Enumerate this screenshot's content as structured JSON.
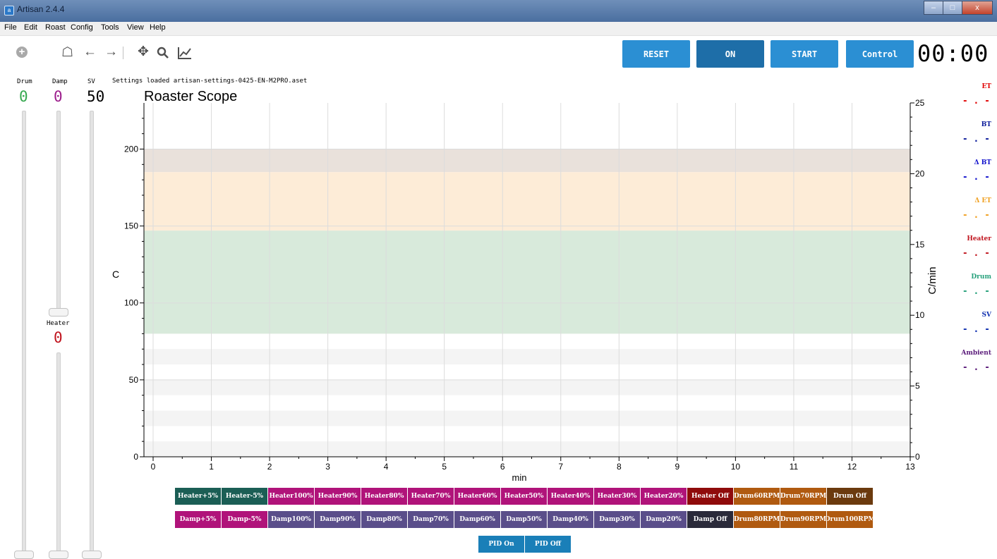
{
  "window": {
    "title": "Artisan 2.4.4",
    "minimize": "–",
    "maximize": "□",
    "close": "x"
  },
  "menu": [
    "File",
    "Edit",
    "Roast",
    "Config",
    "Tools",
    "View",
    "Help"
  ],
  "toolbar_icons": [
    "add-icon",
    "home-icon",
    "back-arrow-icon",
    "forward-arrow-icon",
    "pan-icon",
    "zoom-icon",
    "line-chart-icon"
  ],
  "controls": {
    "reset": "RESET",
    "on": "ON",
    "start": "START",
    "control": "Control"
  },
  "timer": "00:00",
  "lcds": {
    "drum_label": "Drum",
    "drum_value": "0",
    "damp_label": "Damp",
    "damp_value": "0",
    "sv_label": "SV",
    "sv_value": "50",
    "heater_label": "Heater",
    "heater_value": "0"
  },
  "colors": {
    "drum": "#36a84f",
    "damp": "#9c1e8c",
    "sv": "#000000",
    "heater": "#c0141e",
    "zone_top": "#e8e2dc",
    "zone_mid": "#fdecd6",
    "zone_low": "#d7eadb"
  },
  "status_message": "Settings loaded artisan-settings-0425-EN-M2PRO.aset",
  "legend": [
    {
      "name": "ET",
      "value": "- . -",
      "color": "#e00000"
    },
    {
      "name": "BT",
      "value": "- . -",
      "color": "#0a1a9a"
    },
    {
      "name": "Δ BT",
      "value": "- . -",
      "color": "#1010cc"
    },
    {
      "name": "Δ ET",
      "value": "- . -",
      "color": "#f0a020"
    },
    {
      "name": "Heater",
      "value": "- . -",
      "color": "#c0141e"
    },
    {
      "name": "Drum",
      "value": "- . -",
      "color": "#24a07a"
    },
    {
      "name": "SV",
      "value": "- . -",
      "color": "#1030b0"
    },
    {
      "name": "Ambient",
      "value": "- . -",
      "color": "#5a1a7a"
    }
  ],
  "chart_data": {
    "type": "line",
    "title": "Roaster Scope",
    "xlabel": "min",
    "ylabel": "C",
    "y2label": "C/min",
    "xlim": [
      0,
      13
    ],
    "ylim": [
      0,
      230
    ],
    "y2lim": [
      0,
      25
    ],
    "x_ticks": [
      0,
      1,
      2,
      3,
      4,
      5,
      6,
      7,
      8,
      9,
      10,
      11,
      12,
      13
    ],
    "y_ticks": [
      0,
      50,
      100,
      150,
      200
    ],
    "y2_ticks": [
      0,
      5,
      10,
      15,
      20,
      25
    ],
    "grid": true,
    "phase_bands": [
      {
        "from": 185,
        "to": 200,
        "color": "#e9e1db"
      },
      {
        "from": 147,
        "to": 185,
        "color": "#fdecd7"
      },
      {
        "from": 80,
        "to": 147,
        "color": "#d8eadb"
      }
    ],
    "series": []
  },
  "event_buttons_row1": [
    {
      "label": "Heater+5%",
      "color": "#1b5e55"
    },
    {
      "label": "Heater-5%",
      "color": "#1b5e55"
    },
    {
      "label": "Heater100%",
      "color": "#b0137a"
    },
    {
      "label": "Heater90%",
      "color": "#b0137a"
    },
    {
      "label": "Heater80%",
      "color": "#b0137a"
    },
    {
      "label": "Heater70%",
      "color": "#b0137a"
    },
    {
      "label": "Heater60%",
      "color": "#b0137a"
    },
    {
      "label": "Heater50%",
      "color": "#b0137a"
    },
    {
      "label": "Heater40%",
      "color": "#b0137a"
    },
    {
      "label": "Heater30%",
      "color": "#b0137a"
    },
    {
      "label": "Heater20%",
      "color": "#b0137a"
    },
    {
      "label": "Heater Off",
      "color": "#8f0b0b"
    },
    {
      "label": "Drum60RPM",
      "color": "#b05a10"
    },
    {
      "label": "Drum70RPM",
      "color": "#b05a10"
    },
    {
      "label": "Drum Off",
      "color": "#6b3a0e"
    }
  ],
  "event_buttons_row2": [
    {
      "label": "Damp+5%",
      "color": "#b0137a"
    },
    {
      "label": "Damp-5%",
      "color": "#b0137a"
    },
    {
      "label": "Damp100%",
      "color": "#5a4e8a"
    },
    {
      "label": "Damp90%",
      "color": "#5a4e8a"
    },
    {
      "label": "Damp80%",
      "color": "#5a4e8a"
    },
    {
      "label": "Damp70%",
      "color": "#5a4e8a"
    },
    {
      "label": "Damp60%",
      "color": "#5a4e8a"
    },
    {
      "label": "Damp50%",
      "color": "#5a4e8a"
    },
    {
      "label": "Damp40%",
      "color": "#5a4e8a"
    },
    {
      "label": "Damp30%",
      "color": "#5a4e8a"
    },
    {
      "label": "Damp20%",
      "color": "#5a4e8a"
    },
    {
      "label": "Damp Off",
      "color": "#2a2a3a"
    },
    {
      "label": "Drum80RPM",
      "color": "#b05a10"
    },
    {
      "label": "Drum90RPM",
      "color": "#b05a10"
    },
    {
      "label": "Drum100RPM",
      "color": "#b05a10"
    }
  ],
  "pid_buttons": [
    {
      "label": "PID On",
      "color": "#1a7fb8"
    },
    {
      "label": "PID Off",
      "color": "#1a7fb8"
    }
  ]
}
